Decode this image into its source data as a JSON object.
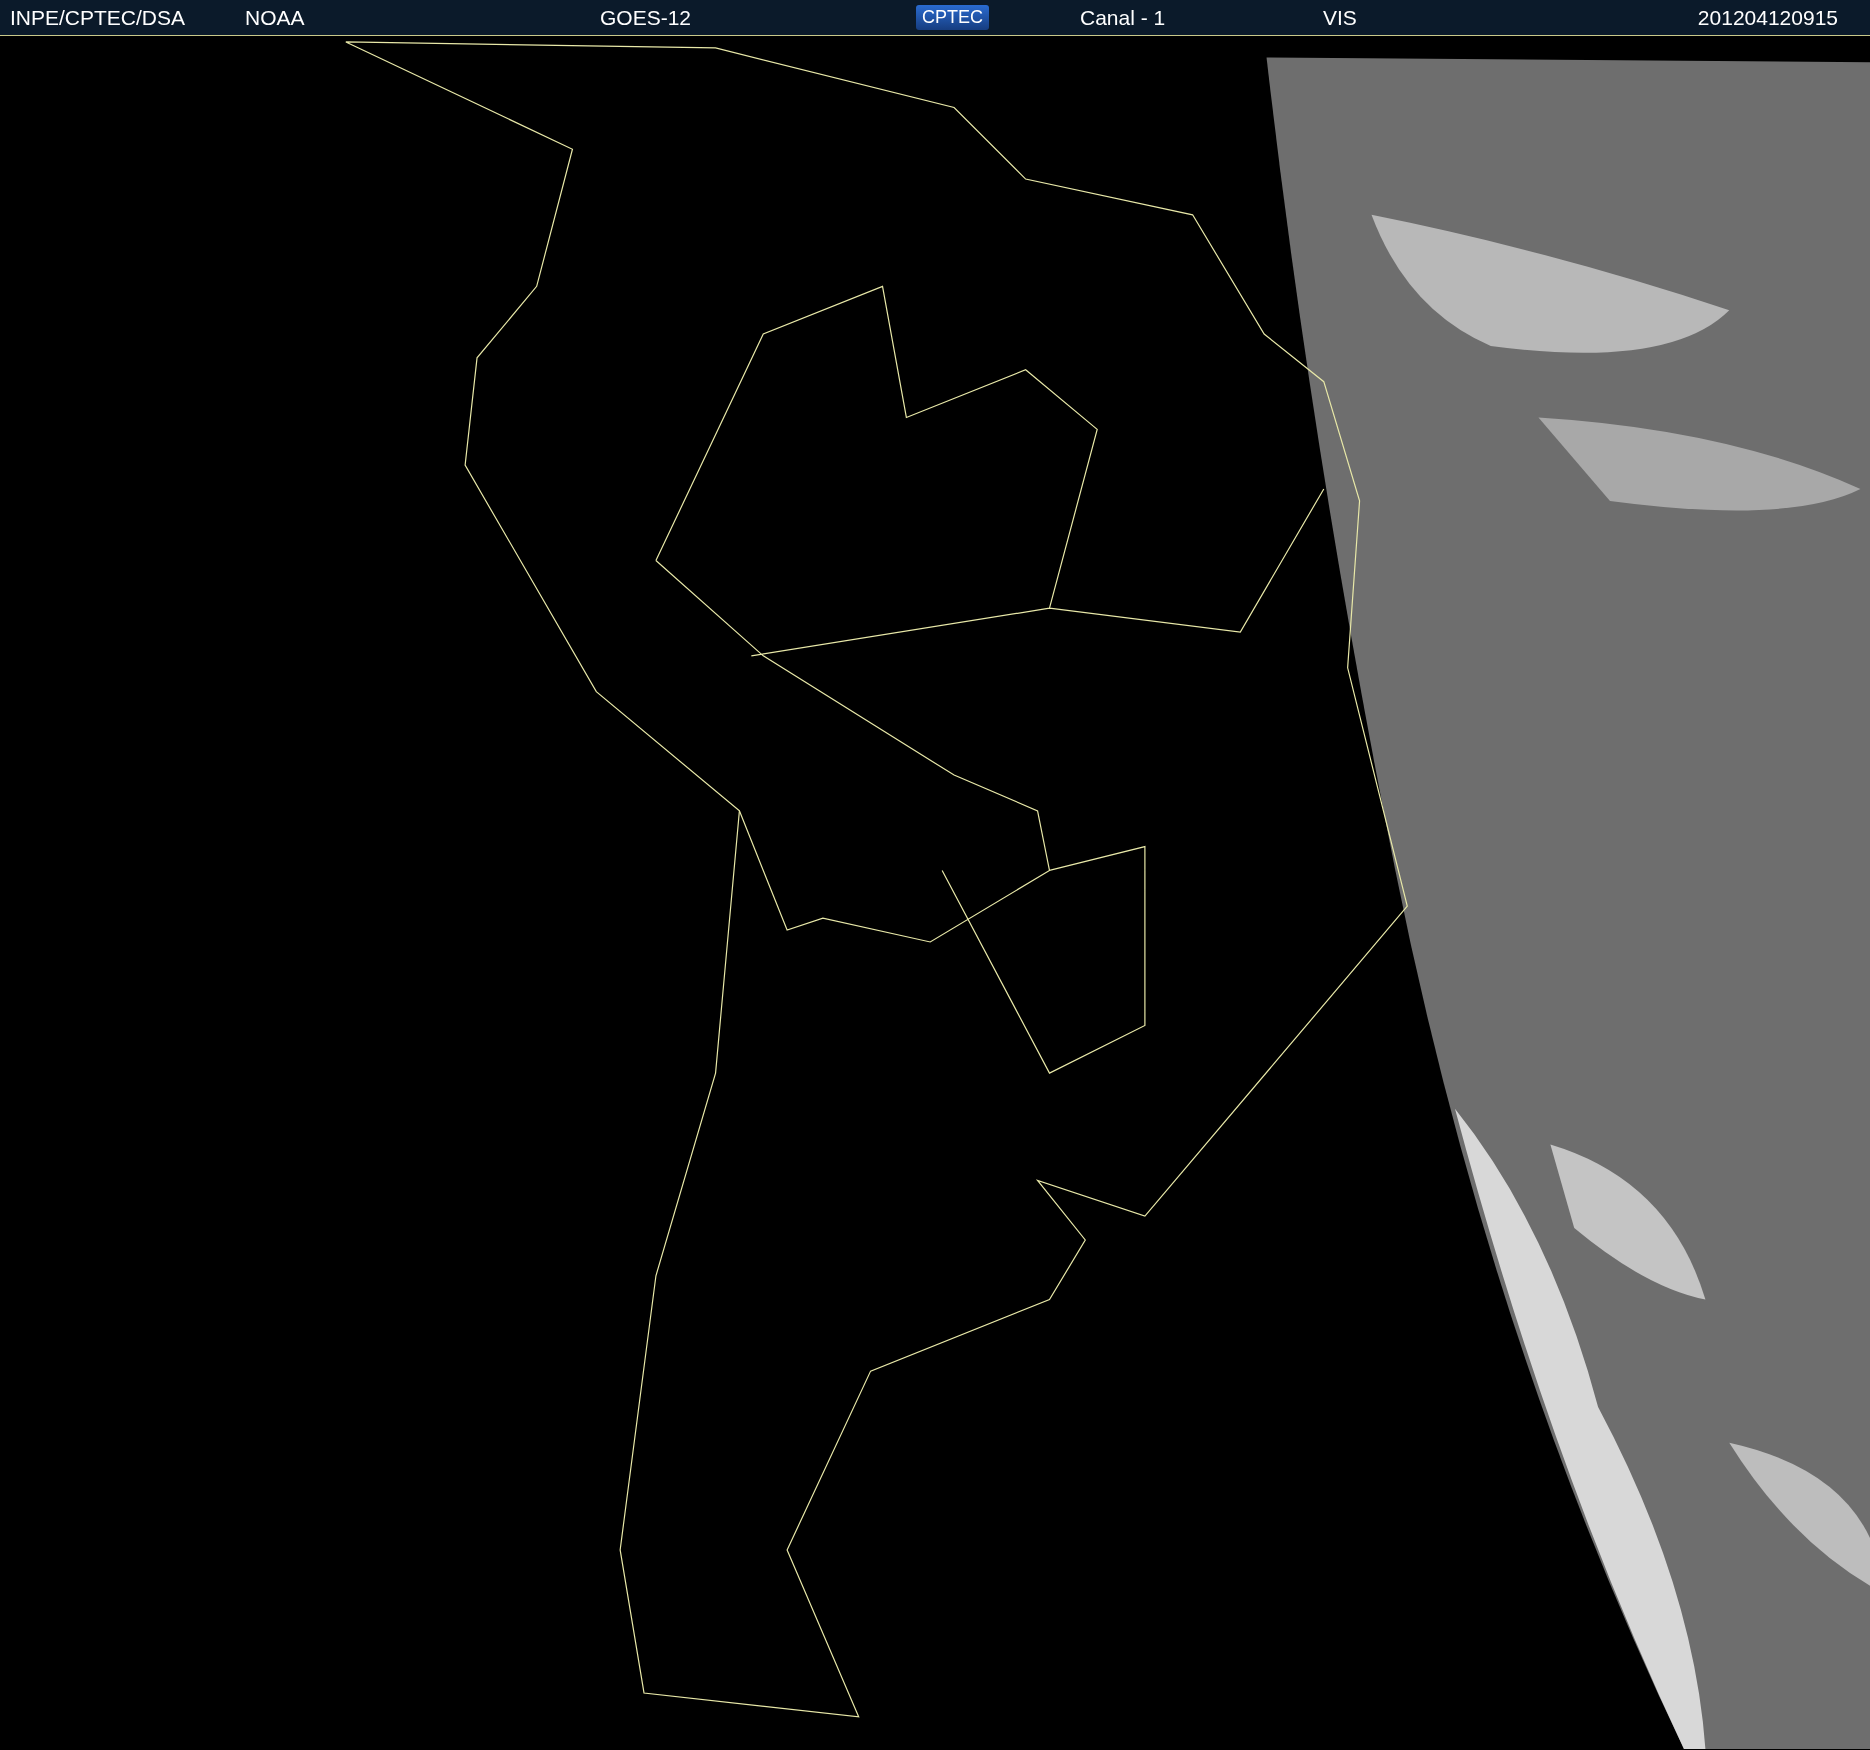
{
  "header": {
    "source": "INPE/CPTEC/DSA",
    "agency": "NOAA",
    "satellite": "GOES-12",
    "logo": "CPTEC",
    "channel": "Canal - 1",
    "band": "VIS",
    "timestamp": "201204120915"
  }
}
